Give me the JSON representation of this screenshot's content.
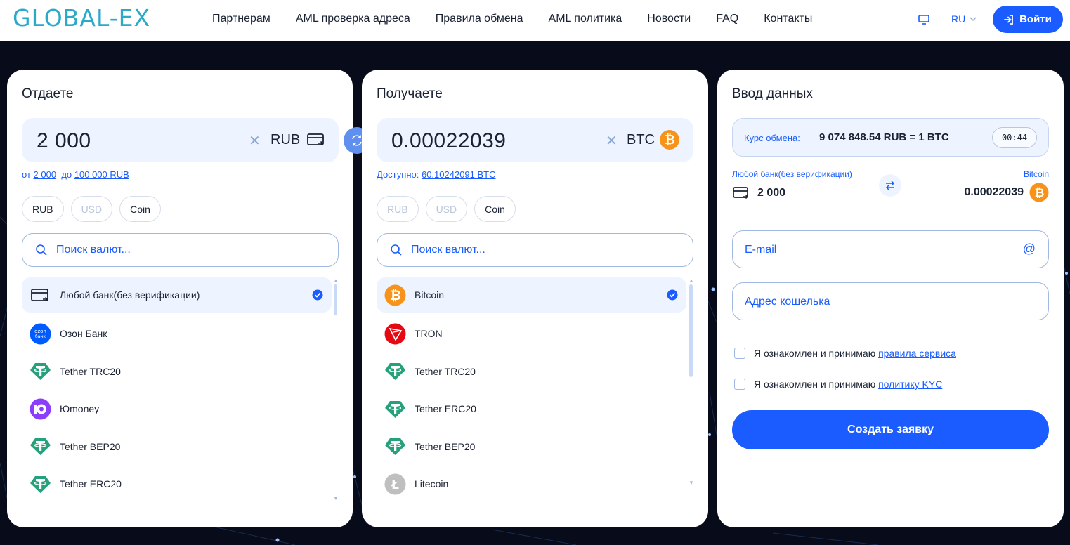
{
  "header": {
    "logo": "GLOBAL-EX",
    "nav": [
      "Партнерам",
      "AML проверка адреса",
      "Правила обмена",
      "AML политика",
      "Новости",
      "FAQ",
      "Контакты"
    ],
    "lang": "RU",
    "login_label": "Войти"
  },
  "give": {
    "title": "Отдаете",
    "amount": "2 000",
    "currency": "RUB",
    "range_from_label": "от",
    "range_from": "2 000",
    "range_to_label": "до",
    "range_to": "100 000 RUB",
    "filters": [
      {
        "label": "RUB",
        "disabled": false
      },
      {
        "label": "USD",
        "disabled": true
      },
      {
        "label": "Coin",
        "disabled": false
      }
    ],
    "search_placeholder": "Поиск валют...",
    "items": [
      {
        "label": "Любой банк(без верификации)",
        "icon": "bank-card-icon",
        "selected": true
      },
      {
        "label": "Озон Банк",
        "icon": "ozon-bank-icon",
        "selected": false
      },
      {
        "label": "Tether TRC20",
        "icon": "tether-icon",
        "selected": false
      },
      {
        "label": "Юmoney",
        "icon": "yoomoney-icon",
        "selected": false
      },
      {
        "label": "Tether BEP20",
        "icon": "tether-icon",
        "selected": false
      },
      {
        "label": "Tether ERC20",
        "icon": "tether-icon",
        "selected": false
      }
    ]
  },
  "get": {
    "title": "Получаете",
    "amount": "0.00022039",
    "currency": "BTC",
    "available_label": "Доступно:",
    "available": "60.10242091 BTC",
    "filters": [
      {
        "label": "RUB",
        "disabled": true
      },
      {
        "label": "USD",
        "disabled": true
      },
      {
        "label": "Coin",
        "disabled": false
      }
    ],
    "search_placeholder": "Поиск валют...",
    "items": [
      {
        "label": "Bitcoin",
        "icon": "bitcoin-icon",
        "selected": true
      },
      {
        "label": "TRON",
        "icon": "tron-icon",
        "selected": false
      },
      {
        "label": "Tether TRC20",
        "icon": "tether-icon",
        "selected": false
      },
      {
        "label": "Tether ERC20",
        "icon": "tether-icon",
        "selected": false
      },
      {
        "label": "Tether BEP20",
        "icon": "tether-icon",
        "selected": false
      },
      {
        "label": "Litecoin",
        "icon": "litecoin-icon",
        "selected": false
      }
    ]
  },
  "data": {
    "title": "Ввод данных",
    "rate_label": "Курс обмена:",
    "rate_value": "9 074 848.54 RUB = 1 BTC",
    "timer": "00:44",
    "from_label": "Любой банк(без верификации)",
    "from_amount": "2 000",
    "to_label": "Bitcoin",
    "to_amount": "0.00022039",
    "email_placeholder": "E-mail",
    "wallet_placeholder": "Адрес кошелька",
    "agree_text": "Я ознакомлен и принимаю",
    "agree_rules_link": "правила сервиса",
    "agree_kyc_link": "политику KYC",
    "submit_label": "Создать заявку"
  },
  "colors": {
    "accent": "#1a5cff",
    "background": "#070b1a",
    "panel": "#ffffff",
    "soft": "#eef4ff",
    "bitcoin": "#f7931a",
    "tether": "#26a17b",
    "tron": "#e50914"
  }
}
